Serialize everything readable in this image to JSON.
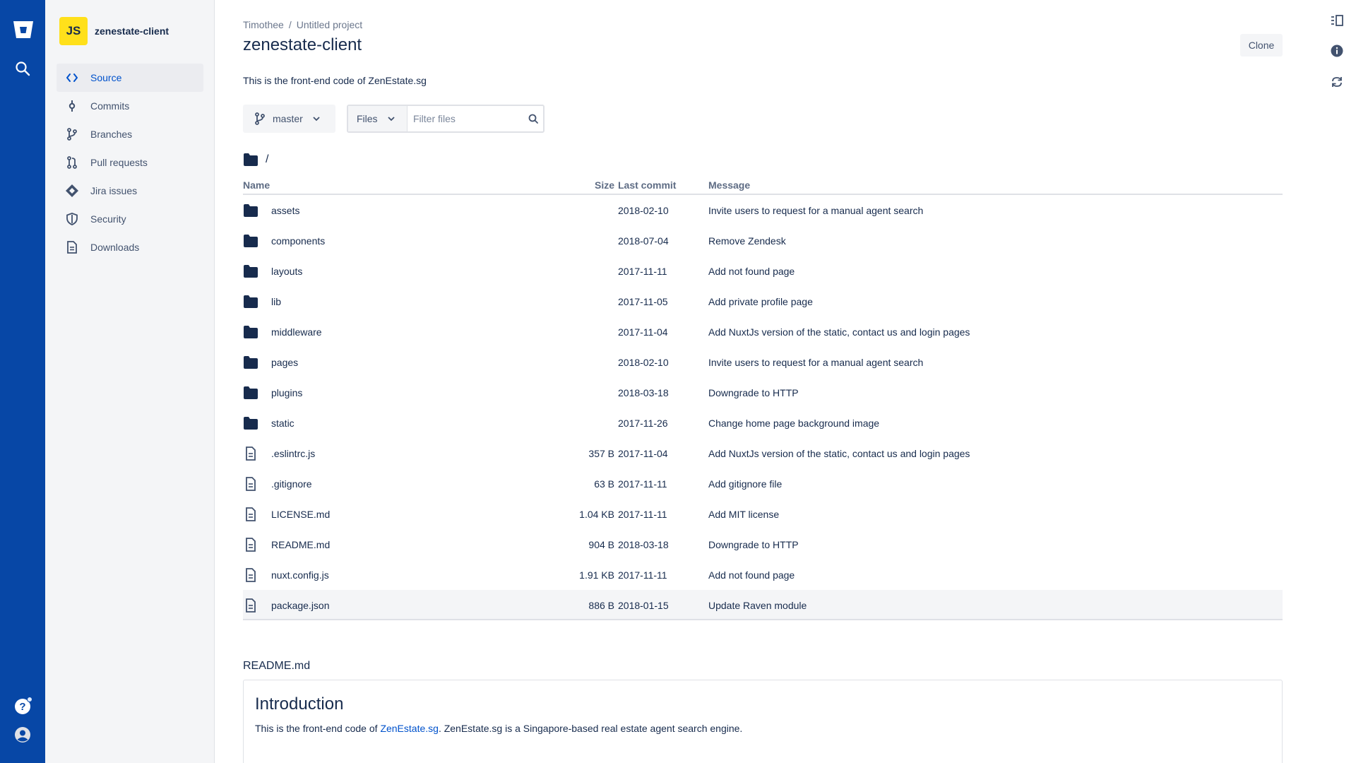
{
  "colors": {
    "global_nav": "#0747A6",
    "accent": "#0052CC",
    "avatar": "#FFE01B"
  },
  "global_nav": {
    "icons": [
      "bitbucket-logo-icon",
      "search-icon",
      "help-icon",
      "profile-icon"
    ]
  },
  "sidebar": {
    "repo_avatar": "JS",
    "repo_name": "zenestate-client",
    "items": [
      {
        "label": "Source",
        "icon": "code-icon",
        "active": true
      },
      {
        "label": "Commits",
        "icon": "commit-icon"
      },
      {
        "label": "Branches",
        "icon": "branch-icon"
      },
      {
        "label": "Pull requests",
        "icon": "pull-request-icon"
      },
      {
        "label": "Jira issues",
        "icon": "jira-icon"
      },
      {
        "label": "Security",
        "icon": "shield-icon"
      },
      {
        "label": "Downloads",
        "icon": "document-icon"
      }
    ]
  },
  "breadcrumb": {
    "owner": "Timothee",
    "sep": "/",
    "project": "Untitled project"
  },
  "page": {
    "title": "zenestate-client",
    "clone_label": "Clone",
    "description": "This is the front-end code of ZenEstate.sg"
  },
  "toolbar": {
    "branch": "master",
    "files_select": "Files",
    "filter_placeholder": "Filter files"
  },
  "path": "/",
  "table": {
    "headers": {
      "name": "Name",
      "size": "Size",
      "last_commit": "Last commit",
      "message": "Message"
    },
    "rows": [
      {
        "type": "folder",
        "name": "assets",
        "size": "",
        "date": "2018-02-10",
        "message": "Invite users to request for a manual agent search"
      },
      {
        "type": "folder",
        "name": "components",
        "size": "",
        "date": "2018-07-04",
        "message": "Remove Zendesk"
      },
      {
        "type": "folder",
        "name": "layouts",
        "size": "",
        "date": "2017-11-11",
        "message": "Add not found page"
      },
      {
        "type": "folder",
        "name": "lib",
        "size": "",
        "date": "2017-11-05",
        "message": "Add private profile page"
      },
      {
        "type": "folder",
        "name": "middleware",
        "size": "",
        "date": "2017-11-04",
        "message": "Add NuxtJs version of the static, contact us and login pages"
      },
      {
        "type": "folder",
        "name": "pages",
        "size": "",
        "date": "2018-02-10",
        "message": "Invite users to request for a manual agent search"
      },
      {
        "type": "folder",
        "name": "plugins",
        "size": "",
        "date": "2018-03-18",
        "message": "Downgrade to HTTP"
      },
      {
        "type": "folder",
        "name": "static",
        "size": "",
        "date": "2017-11-26",
        "message": "Change home page background image"
      },
      {
        "type": "file",
        "name": ".eslintrc.js",
        "size": "357 B",
        "date": "2017-11-04",
        "message": "Add NuxtJs version of the static, contact us and login pages"
      },
      {
        "type": "file",
        "name": ".gitignore",
        "size": "63 B",
        "date": "2017-11-11",
        "message": "Add gitignore file"
      },
      {
        "type": "file",
        "name": "LICENSE.md",
        "size": "1.04 KB",
        "date": "2017-11-11",
        "message": "Add MIT license"
      },
      {
        "type": "file",
        "name": "README.md",
        "size": "904 B",
        "date": "2018-03-18",
        "message": "Downgrade to HTTP"
      },
      {
        "type": "file",
        "name": "nuxt.config.js",
        "size": "1.91 KB",
        "date": "2017-11-11",
        "message": "Add not found page"
      },
      {
        "type": "file",
        "name": "package.json",
        "size": "886 B",
        "date": "2018-01-15",
        "message": "Update Raven module"
      }
    ]
  },
  "readme": {
    "filename": "README.md",
    "heading": "Introduction",
    "text_before": "This is the front-end code of ",
    "link": "ZenEstate.sg",
    "text_after": ". ZenEstate.sg is a Singapore-based real estate agent search engine."
  },
  "right_rail": {
    "icons": [
      "panel-toggle-icon",
      "info-icon",
      "sync-icon"
    ]
  }
}
